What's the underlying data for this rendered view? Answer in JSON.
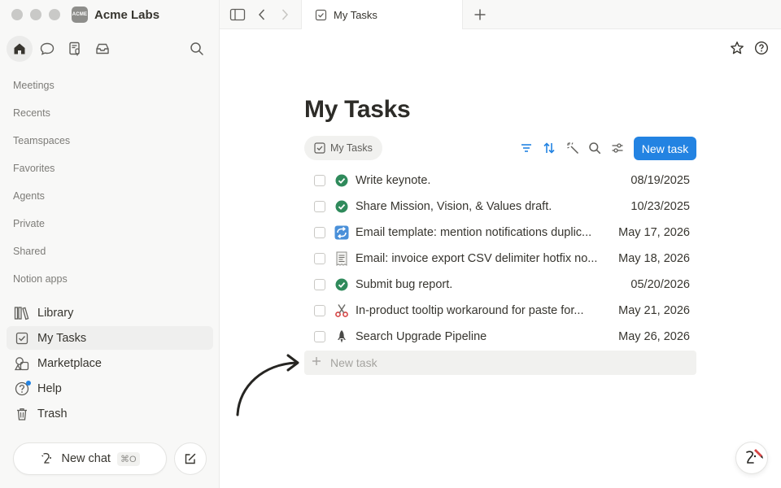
{
  "workspace": {
    "logo_text": "ACME",
    "name": "Acme Labs"
  },
  "sidebar": {
    "sections": [
      "Meetings",
      "Recents",
      "Teamspaces",
      "Favorites",
      "Agents",
      "Private",
      "Shared",
      "Notion apps"
    ],
    "nav": [
      {
        "label": "Library",
        "icon": "library-icon"
      },
      {
        "label": "My Tasks",
        "icon": "checkbox-icon",
        "active": true
      },
      {
        "label": "Marketplace",
        "icon": "marketplace-icon"
      },
      {
        "label": "Help",
        "icon": "help-icon",
        "badge": true
      },
      {
        "label": "Trash",
        "icon": "trash-icon"
      }
    ],
    "new_chat": {
      "label": "New chat",
      "shortcut": "⌘O"
    }
  },
  "tabbar": {
    "tab_label": "My Tasks"
  },
  "page": {
    "title": "My Tasks",
    "view_label": "My Tasks",
    "new_task_button": "New task",
    "new_task_placeholder": "New task",
    "tasks": [
      {
        "name": "Write keynote.",
        "date": "08/19/2025",
        "icon": "check-circle-icon"
      },
      {
        "name": "Share Mission, Vision, & Values draft.",
        "date": "10/23/2025",
        "icon": "check-circle-icon"
      },
      {
        "name": "Email template: mention notifications duplic...",
        "date": "May 17, 2026",
        "icon": "repeat-emoji-icon"
      },
      {
        "name": "Email: invoice export CSV delimiter hotfix no...",
        "date": "May 18, 2026",
        "icon": "receipt-emoji-icon"
      },
      {
        "name": "Submit bug report.",
        "date": "05/20/2026",
        "icon": "check-circle-icon"
      },
      {
        "name": "In-product tooltip workaround for paste for...",
        "date": "May 21, 2026",
        "icon": "scissors-emoji-icon"
      },
      {
        "name": "Search Upgrade Pipeline",
        "date": "May 26, 2026",
        "icon": "rocket-emoji-icon"
      }
    ]
  },
  "colors": {
    "accent": "#2383e2",
    "check_green": "#2f8a5b",
    "sidebar_bg": "#f8f8f7"
  }
}
